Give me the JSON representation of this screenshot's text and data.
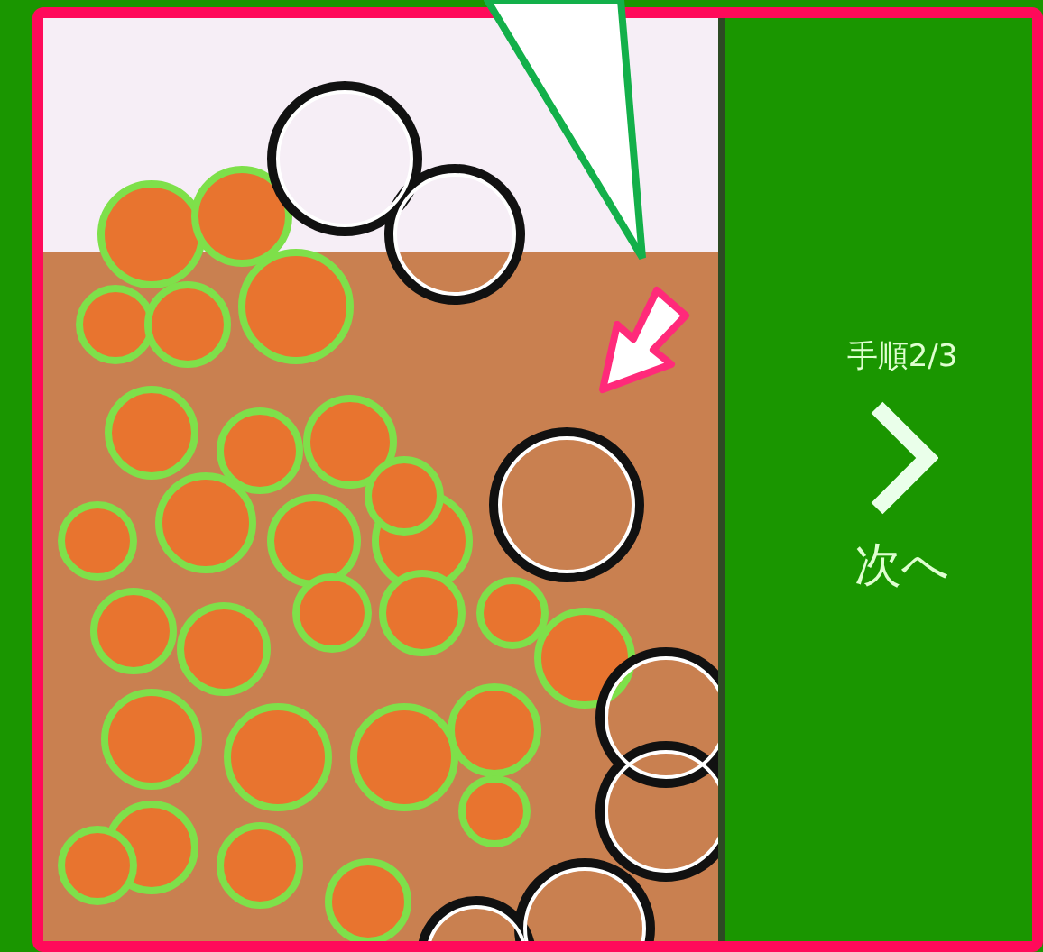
{
  "step_indicator": "手順2/3",
  "next_button": {
    "label": "次へ"
  }
}
